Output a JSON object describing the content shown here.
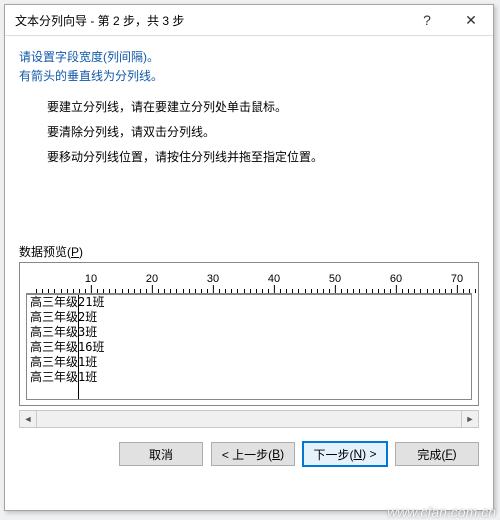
{
  "titlebar": {
    "title": "文本分列向导 - 第 2 步，共 3 步",
    "help_label": "?",
    "close_label": "✕"
  },
  "intro": {
    "line1": "请设置字段宽度(列间隔)。",
    "line2": "有箭头的垂直线为分列线。"
  },
  "instructions": {
    "create": "要建立分列线，请在要建立分列处单击鼠标。",
    "remove": "要清除分列线，请双击分列线。",
    "move": "要移动分列线位置，请按住分列线并拖至指定位置。"
  },
  "preview": {
    "label": "数据预览(",
    "hotkey": "P",
    "label_after": ")",
    "ruler_ticks": [
      10,
      20,
      30,
      40,
      50,
      60,
      70
    ],
    "break_col": 4,
    "rows": [
      "高三年级21班",
      "高三年级2班",
      "高三年级3班",
      "高三年级16班",
      "高三年级1班",
      "高三年级1班"
    ]
  },
  "buttons": {
    "cancel": "取消",
    "back_prefix": "< 上一步(",
    "back_hotkey": "B",
    "back_suffix": ")",
    "next_prefix": "下一步(",
    "next_hotkey": "N",
    "next_suffix": ") >",
    "finish_prefix": "完成(",
    "finish_hotkey": "F",
    "finish_suffix": ")"
  },
  "scroll": {
    "left": "◄",
    "right": "►"
  },
  "watermark": "www.cfan.com.cn"
}
